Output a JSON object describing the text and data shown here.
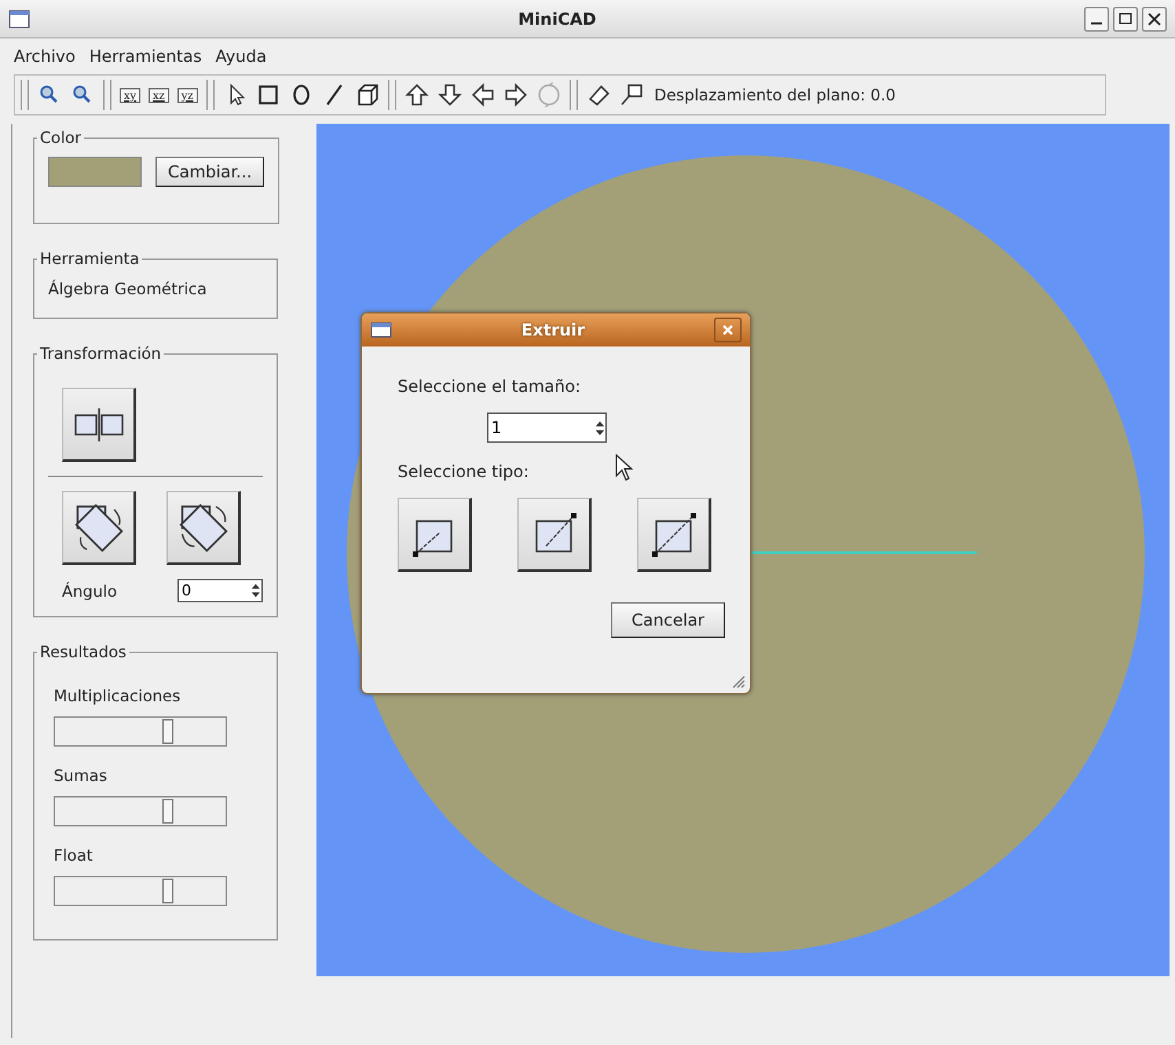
{
  "window": {
    "title": "MiniCAD"
  },
  "menu": [
    "Archivo",
    "Herramientas",
    "Ayuda"
  ],
  "toolbar": {
    "plane_buttons": [
      "xy",
      "xz",
      "yz"
    ],
    "status": "Desplazamiento del plano: 0.0"
  },
  "color": {
    "legend": "Color",
    "color": "#a3a077",
    "button": "Cambiar..."
  },
  "tool": {
    "legend": "Herramienta",
    "value": "Álgebra Geométrica"
  },
  "transform": {
    "legend": "Transformación",
    "angle_label": "Ángulo",
    "angle_value": "0"
  },
  "results": {
    "legend": "Resultados",
    "items": [
      {
        "label": "Multiplicaciones",
        "level": 0.66
      },
      {
        "label": "Sumas",
        "level": 0.66
      },
      {
        "label": "Float",
        "level": 0.66
      }
    ]
  },
  "dialog": {
    "title": "Extruir",
    "size_label": "Seleccione el tamaño:",
    "size_value": "1",
    "type_label": "Seleccione tipo:",
    "cancel": "Cancelar"
  }
}
